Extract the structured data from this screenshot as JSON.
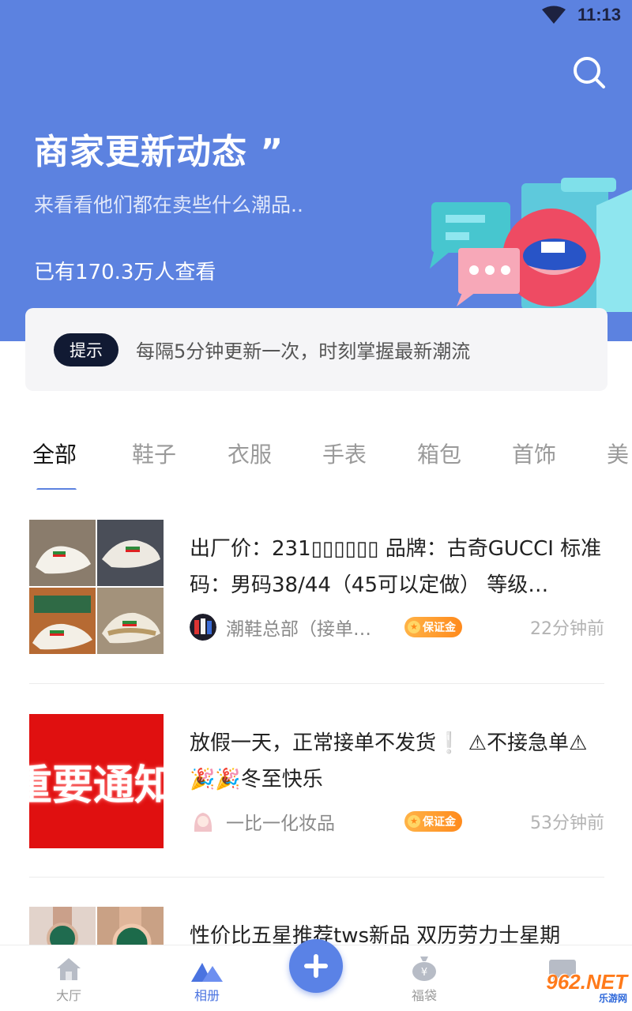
{
  "status_bar": {
    "time": "11:13"
  },
  "hero": {
    "title": "商家更新动态 ”",
    "subtitle": "来看看他们都在卖些什么潮品..",
    "views": "已有170.3万人查看"
  },
  "tip": {
    "badge": "提示",
    "text": "每隔5分钟更新一次，时刻掌握最新潮流"
  },
  "tabs": [
    {
      "label": "全部",
      "active": true
    },
    {
      "label": "鞋子"
    },
    {
      "label": "衣服"
    },
    {
      "label": "手表"
    },
    {
      "label": "箱包"
    },
    {
      "label": "首饰"
    },
    {
      "label": "美"
    }
  ],
  "feed": [
    {
      "title": "出厂价：231▯▯▯▯▯▯ 品牌：古奇GUCCI 标准码：男码38/44（45可以定做） 等级…",
      "shop": "潮鞋总部（接单…",
      "badge": "保证金",
      "time": "22分钟前"
    },
    {
      "title": "放假一天，正常接单不发货❕ ⚠不接急单⚠ 🎉🎉冬至快乐",
      "image_text": "重要通知",
      "shop": "一比一化妆品",
      "badge": "保证金",
      "time": "53分钟前"
    },
    {
      "title": "性价比五星推荐tws新品 双历劳力士星期"
    }
  ],
  "bottom_nav": [
    {
      "label": "大厅",
      "icon": "home-icon"
    },
    {
      "label": "相册",
      "icon": "mountain-icon",
      "active": true
    },
    {
      "label": "福袋",
      "icon": "money-bag-icon"
    },
    {
      "label": "",
      "icon": "chat-icon"
    }
  ],
  "watermark": {
    "brand": "962.NET",
    "sub": "乐游网"
  },
  "colors": {
    "primary": "#5c82e0",
    "badge_orange": "#ff8a1c",
    "notice_red": "#e01010"
  }
}
